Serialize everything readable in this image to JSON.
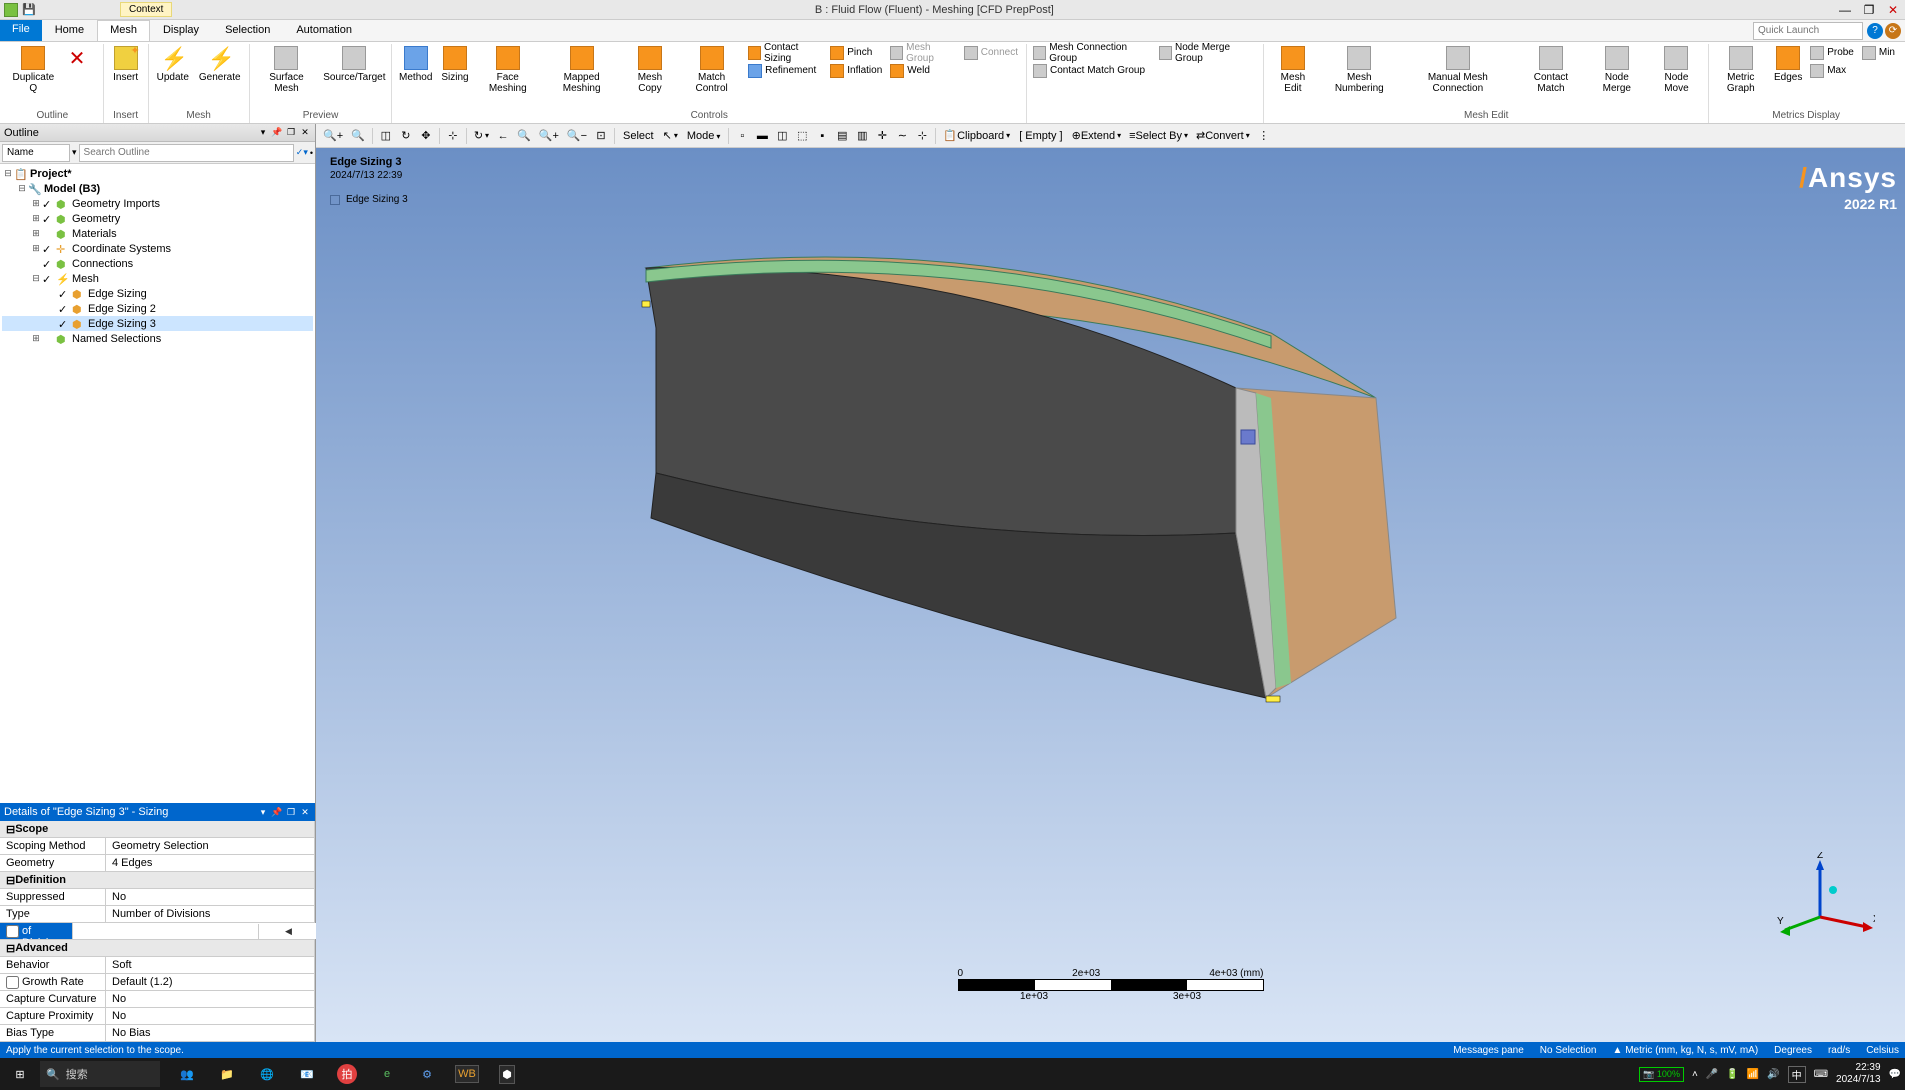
{
  "title": "B : Fluid Flow (Fluent) - Meshing [CFD PrepPost]",
  "context": "Context",
  "quick_launch": "Quick Launch",
  "tabs": {
    "file": "File",
    "home": "Home",
    "mesh": "Mesh",
    "display": "Display",
    "selection": "Selection",
    "automation": "Automation"
  },
  "ribbon": {
    "duplicate": "Duplicate",
    "outline": "Outline",
    "insert": "Insert",
    "insert_grp": "Insert",
    "update": "Update",
    "generate": "Generate",
    "mesh_grp": "Mesh",
    "surface_mesh": "Surface\nMesh",
    "source_target": "Source/Target",
    "preview_grp": "Preview",
    "method": "Method",
    "sizing": "Sizing",
    "face_meshing": "Face\nMeshing",
    "mapped_meshing": "Mapped\nMeshing",
    "mesh_copy": "Mesh\nCopy",
    "match_control": "Match\nControl",
    "contact_sizing": "Contact Sizing",
    "pinch": "Pinch",
    "refinement": "Refinement",
    "inflation": "Inflation",
    "weld": "Weld",
    "mesh_group": "Mesh Group",
    "connect": "Connect",
    "controls_grp": "Controls",
    "mesh_connection_group": "Mesh Connection Group",
    "node_merge_group": "Node Merge Group",
    "contact_match_group": "Contact Match Group",
    "mesh_edit": "Mesh\nEdit",
    "mesh_numbering": "Mesh\nNumbering",
    "manual_mesh_connection": "Manual Mesh\nConnection",
    "contact_match": "Contact\nMatch",
    "node_merge": "Node\nMerge",
    "node_move": "Node\nMove",
    "mesh_edit_grp": "Mesh Edit",
    "metric_graph": "Metric\nGraph",
    "edges": "Edges",
    "probe": "Probe",
    "min": "Min",
    "max": "Max",
    "metrics_display_grp": "Metrics Display"
  },
  "outline": {
    "title": "Outline",
    "name": "Name",
    "search": "Search Outline",
    "project": "Project*",
    "model": "Model (B3)",
    "geom_imports": "Geometry Imports",
    "geometry": "Geometry",
    "materials": "Materials",
    "coord": "Coordinate Systems",
    "connections": "Connections",
    "mesh": "Mesh",
    "edge1": "Edge Sizing",
    "edge2": "Edge Sizing 2",
    "edge3": "Edge Sizing 3",
    "named": "Named Selections"
  },
  "details": {
    "title": "Details of \"Edge Sizing 3\" - Sizing",
    "scope": "Scope",
    "scoping_method": "Scoping Method",
    "scoping_method_val": "Geometry Selection",
    "geometry": "Geometry",
    "geometry_val": "4 Edges",
    "definition": "Definition",
    "suppressed": "Suppressed",
    "suppressed_val": "No",
    "type": "Type",
    "type_val": "Number of Divisions",
    "num_div": "Number of Divisions",
    "num_div_val": "",
    "advanced": "Advanced",
    "behavior": "Behavior",
    "behavior_val": "Soft",
    "growth": "Growth Rate",
    "growth_val": "Default (1.2)",
    "curvature": "Capture Curvature",
    "curvature_val": "No",
    "proximity": "Capture Proximity",
    "proximity_val": "No",
    "bias": "Bias Type",
    "bias_val": "No Bias"
  },
  "viewport_toolbar": {
    "select": "Select",
    "mode": "Mode",
    "clipboard": "Clipboard",
    "empty": "[ Empty ]",
    "extend": "Extend",
    "select_by": "Select By",
    "convert": "Convert"
  },
  "viewport": {
    "label": "Edge Sizing 3",
    "date": "2024/7/13 22:39",
    "legend": "Edge Sizing 3",
    "ansys": "Ansys",
    "version": "2022 R1"
  },
  "scale": {
    "t0": "0",
    "t1": "2e+03",
    "t2": "4e+03 (mm)",
    "b1": "1e+03",
    "b2": "3e+03"
  },
  "triad": {
    "x": "X",
    "y": "Y",
    "z": "Z"
  },
  "status": {
    "msg": "Apply the current selection to the scope.",
    "messages": "Messages pane",
    "selection": "No Selection",
    "units": "Metric (mm, kg, N, s, mV, mA)",
    "degrees": "Degrees",
    "rads": "rad/s",
    "celsius": "Celsius"
  },
  "taskbar": {
    "search": "搜索",
    "zoom": "100%",
    "ime": "中",
    "time": "22:39",
    "date": "2024/7/13"
  }
}
